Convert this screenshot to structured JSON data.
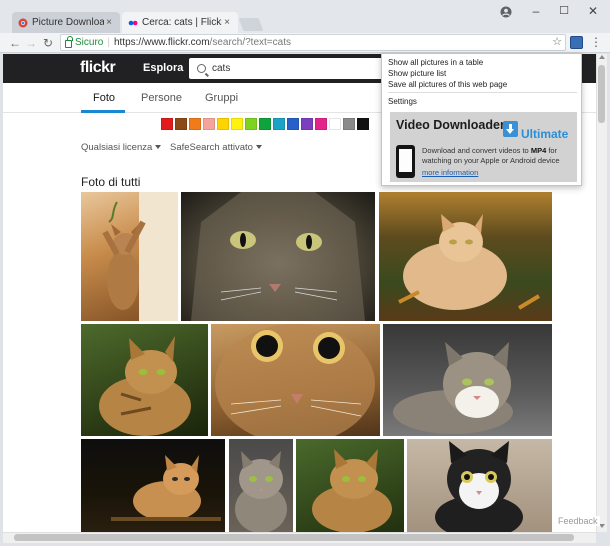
{
  "browser": {
    "tabs": [
      {
        "title": "Picture Downloader Profe",
        "active": false
      },
      {
        "title": "Cerca: cats | Flickr",
        "active": true
      }
    ],
    "address": {
      "secure_label": "Sicuro",
      "url_prefix": "https://www.flickr.com",
      "url_path": "/search/?text=cats"
    }
  },
  "flickr": {
    "logo": "flickr",
    "nav_explore": "Esplora",
    "search_value": "cats",
    "tabs": [
      {
        "label": "Foto",
        "active": true
      },
      {
        "label": "Persone",
        "active": false
      },
      {
        "label": "Gruppi",
        "active": false
      }
    ],
    "color_swatches": [
      "#e21c1c",
      "#8c4a17",
      "#f17a1a",
      "#f5a49b",
      "#ffd400",
      "#fff20c",
      "#7ed321",
      "#0fa33b",
      "#1aa3c7",
      "#2860c9",
      "#7c3fbf",
      "#e3258b",
      "#ffffff",
      "#8a8a8a",
      "#111111"
    ],
    "filter_license": "Qualsiasi licenza",
    "filter_safesearch": "SafeSearch attivato",
    "section_title": "Foto di tutti",
    "feedback": "Feedback"
  },
  "popup": {
    "links": [
      "Show all pictures in a table",
      "Show picture list",
      "Save all pictures of this web page"
    ],
    "settings": "Settings",
    "promo": {
      "title": "Video Downloader",
      "badge": "Ultimate",
      "desc_before": "Download and convert videos to ",
      "desc_bold": "MP4",
      "desc_after": " for watching on your Apple or Android device",
      "link": "more information"
    }
  }
}
